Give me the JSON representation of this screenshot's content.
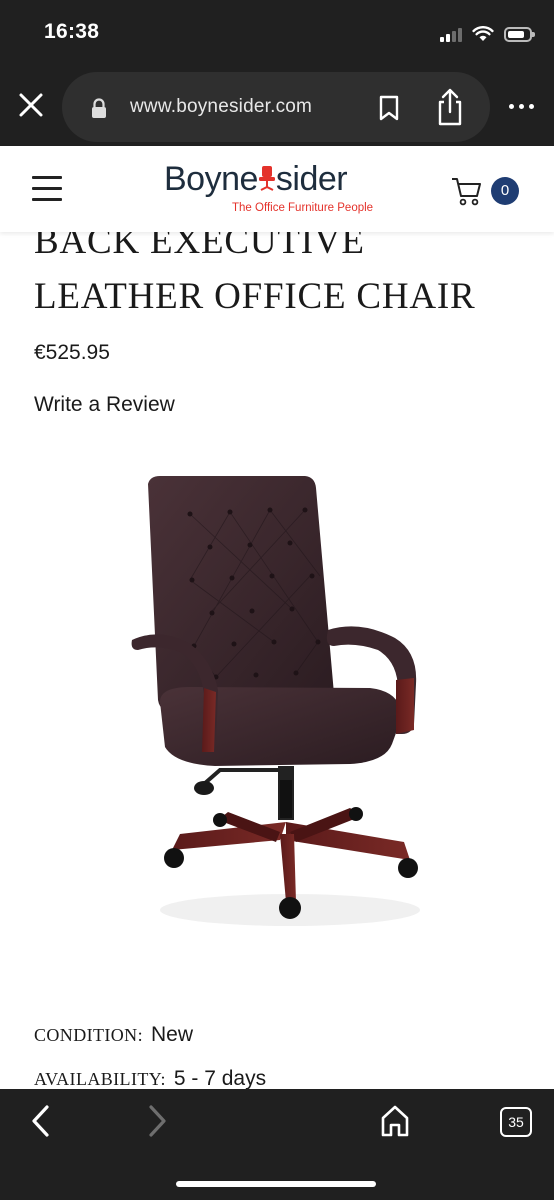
{
  "status_bar": {
    "time": "16:38",
    "icons": [
      "cellular-signal-icon",
      "wifi-icon",
      "battery-icon"
    ]
  },
  "browser": {
    "url": "www.boynesider.com",
    "icons": [
      "close-icon",
      "lock-icon",
      "bookmark-icon",
      "share-icon",
      "more-icon"
    ],
    "tab_count": "35",
    "bottom_icons": [
      "back-arrow-icon",
      "forward-arrow-icon",
      "home-icon",
      "tabs-icon"
    ]
  },
  "site_header": {
    "logo_text_left": "Boyne",
    "logo_text_right": "sider",
    "tagline": "The Office Furniture People",
    "cart_count": "0",
    "colors": {
      "brand_navy": "#1e2d3d",
      "brand_red": "#e4322b",
      "badge": "#1f3d73"
    }
  },
  "product": {
    "title_line1": "BACK EXECUTIVE",
    "title_line2": "LEATHER OFFICE CHAIR",
    "price": "€525.95",
    "review_link": "Write a Review",
    "image_icon": "burgundy-leather-office-chair",
    "specs": [
      {
        "label": "CONDITION:",
        "value": "New"
      },
      {
        "label": "AVAILABILITY:",
        "value": "5 - 7 days"
      }
    ]
  }
}
